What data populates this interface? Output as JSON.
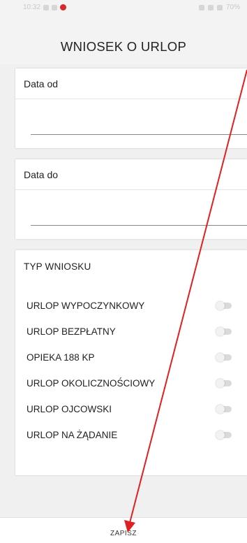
{
  "status_bar": {
    "time": "10:32",
    "battery": "70%"
  },
  "app_bar": {
    "title": "WNIOSEK O URLOP"
  },
  "date_from": {
    "label": "Data od",
    "value": ""
  },
  "date_to": {
    "label": "Data do",
    "value": ""
  },
  "request_type": {
    "title": "TYP WNIOSKU",
    "options": [
      {
        "label": "URLOP WYPOCZYNKOWY",
        "checked": false
      },
      {
        "label": "URLOP BEZPŁATNY",
        "checked": false
      },
      {
        "label": "OPIEKA 188 KP",
        "checked": false
      },
      {
        "label": "URLOP OKOLICZNOŚCIOWY",
        "checked": false
      },
      {
        "label": "URLOP OJCOWSKI",
        "checked": false
      },
      {
        "label": "URLOP NA ŻĄDANIE",
        "checked": false
      }
    ]
  },
  "footer": {
    "save_label": "ZAPISZ"
  },
  "colors": {
    "annotation_arrow": "#e02020",
    "switch_off_track": "#dadada",
    "background": "#f0f0f0"
  }
}
